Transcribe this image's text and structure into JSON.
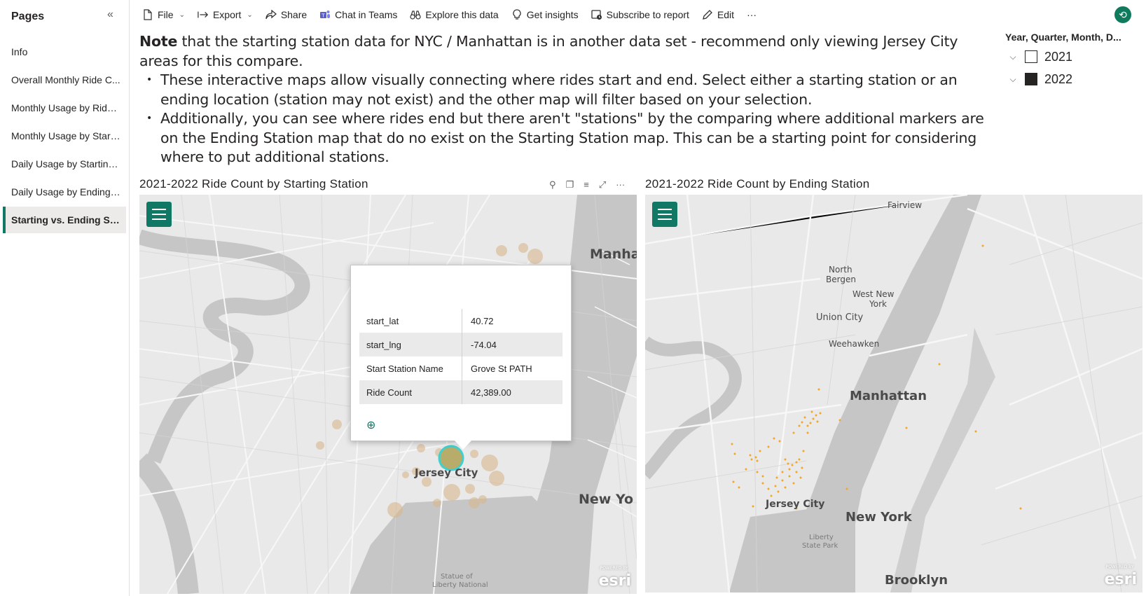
{
  "sidebar": {
    "title": "Pages",
    "collapse_icon": "«",
    "items": [
      {
        "label": "Info",
        "active": false
      },
      {
        "label": "Overall Monthly Ride C...",
        "active": false
      },
      {
        "label": "Monthly Usage by Rider...",
        "active": false
      },
      {
        "label": "Monthly Usage by Starti...",
        "active": false
      },
      {
        "label": "Daily Usage by Starting ...",
        "active": false
      },
      {
        "label": "Daily Usage by Ending S...",
        "active": false
      },
      {
        "label": "Starting vs. Ending Stat...",
        "active": true
      }
    ]
  },
  "toolbar": {
    "file": "File",
    "export": "Export",
    "share": "Share",
    "chat": "Chat in Teams",
    "explore": "Explore this data",
    "insights": "Get insights",
    "subscribe": "Subscribe to report",
    "edit": "Edit",
    "more": "···"
  },
  "note": {
    "bold": "Note",
    "intro": " that the starting station data for NYC / Manhattan is in another data set - recommend only viewing Jersey City areas for this compare.",
    "bullets": [
      "These interactive maps allow visually connecting where rides start and end. Select either a starting station or an ending location (station may not exist) and the other map will filter based on your selection.",
      "Additionally, you can see where rides end but there aren't \"stations\" by the comparing where additional markers are on the Ending Station map that do no exist on the Starting Station map. This can be a starting point for considering where to put additional stations."
    ]
  },
  "slicer": {
    "title": "Year, Quarter, Month, D...",
    "items": [
      {
        "label": "2021",
        "checked": false
      },
      {
        "label": "2022",
        "checked": true
      }
    ]
  },
  "map_left": {
    "title": "2021-2022 Ride Count by Starting Station",
    "labels": {
      "manhattan": "Manha",
      "jersey_city": "Jersey City",
      "new_york": "New Yo",
      "statue": "Statue of",
      "liberty": "Liberty National"
    },
    "esri": "esri",
    "esri_small": "POWERED BY"
  },
  "map_right": {
    "title": "2021-2022 Ride Count by Ending Station",
    "labels": {
      "fairview": "Fairview",
      "north_bergen": "North",
      "north_bergen2": "Bergen",
      "west_ny": "West New",
      "west_ny2": "York",
      "union_city": "Union City",
      "weehawken": "Weehawken",
      "manhattan": "Manhattan",
      "jersey_city": "Jersey City",
      "new_york": "New York",
      "liberty": "Liberty",
      "liberty2": "State Park",
      "brooklyn": "Brooklyn"
    },
    "esri": "esri",
    "esri_small": "POWERED BY"
  },
  "tooltip": {
    "rows": [
      {
        "key": "start_lat",
        "value": "40.72"
      },
      {
        "key": "start_lng",
        "value": "-74.04"
      },
      {
        "key": "Start Station Name",
        "value": "Grove St PATH"
      },
      {
        "key": "Ride Count",
        "value": "42,389.00"
      }
    ]
  },
  "colors": {
    "accent": "#117865",
    "bubble": "#d9b68f",
    "dot": "#f5a623",
    "water": "#c3c3c3",
    "land": "#e8e8e8"
  }
}
